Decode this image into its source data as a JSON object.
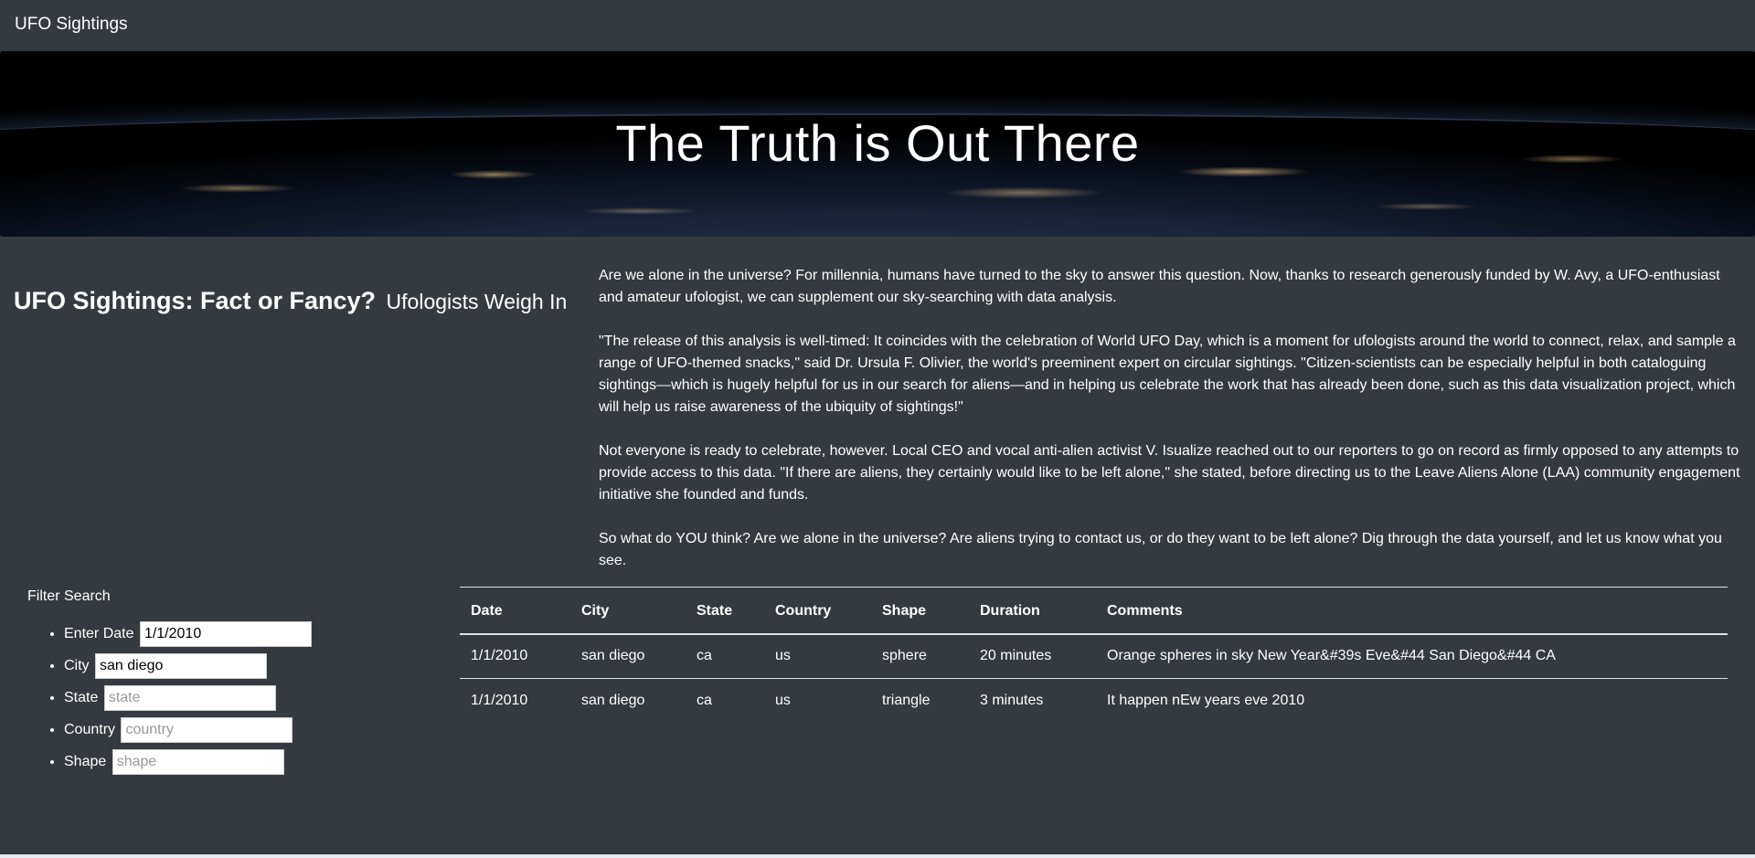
{
  "navbar": {
    "brand": "UFO Sightings"
  },
  "hero": {
    "title": "The Truth is Out There"
  },
  "article": {
    "title": "UFO Sightings: Fact or Fancy?",
    "subtitle": "Ufologists Weigh In",
    "paragraphs": [
      "Are we alone in the universe? For millennia, humans have turned to the sky to answer this question. Now, thanks to research generously funded by W. Avy, a UFO-enthusiast and amateur ufologist, we can supplement our sky-searching with data analysis.",
      "\"The release of this analysis is well-timed: It coincides with the celebration of World UFO Day, which is a moment for ufologists around the world to connect, relax, and sample a range of UFO-themed snacks,\" said Dr. Ursula F. Olivier, the world's preeminent expert on circular sightings. \"Citizen-scientists can be especially helpful in both cataloguing sightings—which is hugely helpful for us in our search for aliens—and in helping us celebrate the work that has already been done, such as this data visualization project, which will help us raise awareness of the ubiquity of sightings!\"",
      "Not everyone is ready to celebrate, however. Local CEO and vocal anti-alien activist V. Isualize reached out to our reporters to go on record as firmly opposed to any attempts to provide access to this data. \"If there are aliens, they certainly would like to be left alone,\" she stated, before directing us to the Leave Aliens Alone (LAA) community engagement initiative she founded and funds.",
      "So what do YOU think? Are we alone in the universe? Are aliens trying to contact us, or do they want to be left alone? Dig through the data yourself, and let us know what you see."
    ]
  },
  "filters": {
    "heading": "Filter Search",
    "items": [
      {
        "label": "Enter Date",
        "value": "1/1/2010",
        "placeholder": ""
      },
      {
        "label": "City",
        "value": "san diego",
        "placeholder": ""
      },
      {
        "label": "State",
        "value": "",
        "placeholder": "state"
      },
      {
        "label": "Country",
        "value": "",
        "placeholder": "country"
      },
      {
        "label": "Shape",
        "value": "",
        "placeholder": "shape"
      }
    ]
  },
  "table": {
    "headers": [
      "Date",
      "City",
      "State",
      "Country",
      "Shape",
      "Duration",
      "Comments"
    ],
    "rows": [
      [
        "1/1/2010",
        "san diego",
        "ca",
        "us",
        "sphere",
        "20 minutes",
        "Orange spheres in sky New Year&#39s Eve&#44 San Diego&#44 CA"
      ],
      [
        "1/1/2010",
        "san diego",
        "ca",
        "us",
        "triangle",
        "3 minutes",
        "It happen nEw years eve 2010"
      ]
    ]
  }
}
